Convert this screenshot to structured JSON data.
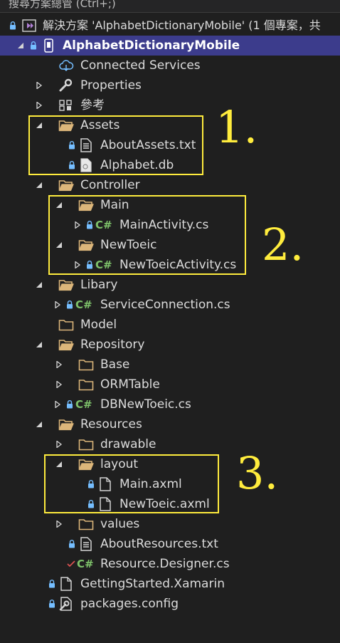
{
  "search": {
    "text": "搜尋方案總管 (Ctrl+;)"
  },
  "solution": {
    "label": "解決方案 'AlphabetDictionaryMobile' (1 個專案，共"
  },
  "project": {
    "label": "AlphabetDictionaryMobile"
  },
  "tree": {
    "connected_services": "Connected Services",
    "properties": "Properties",
    "references": "參考",
    "assets": "Assets",
    "about_assets": "AboutAssets.txt",
    "alphabet_db": "Alphabet.db",
    "controller": "Controller",
    "main": "Main",
    "main_activity": "MainActivity.cs",
    "new_toeic": "NewToeic",
    "new_toeic_activity": "NewToeicActivity.cs",
    "libary": "Libary",
    "service_connection": "ServiceConnection.cs",
    "model": "Model",
    "repository": "Repository",
    "base": "Base",
    "orm_table": "ORMTable",
    "db_new_toeic": "DBNewToeic.cs",
    "resources": "Resources",
    "drawable": "drawable",
    "layout": "layout",
    "main_axml": "Main.axml",
    "new_toeic_axml": "NewToeic.axml",
    "values": "values",
    "about_resources": "AboutResources.txt",
    "resource_designer": "Resource.Designer.cs",
    "getting_started": "GettingStarted.Xamarin",
    "packages_config": "packages.config"
  },
  "icons": {
    "cs_badge": "C#"
  },
  "annotations": {
    "one": "1.",
    "two": "2.",
    "three": "3."
  },
  "colors": {
    "background": "#1f1f1f",
    "selection": "#3c3c8c",
    "folder": "#dcb67a",
    "csharp": "#7ec26a",
    "lock": "#75beff",
    "highlight": "#ffec3d"
  }
}
